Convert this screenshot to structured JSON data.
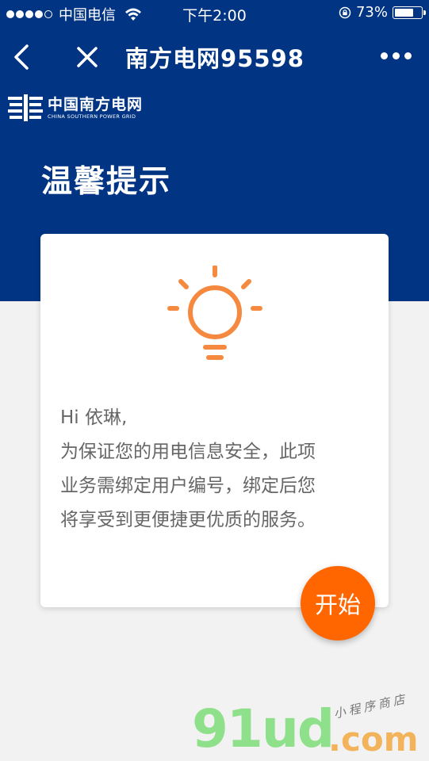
{
  "status_bar": {
    "carrier": "中国电信",
    "time": "下午2:00",
    "battery_percent": "73%",
    "battery_level": 0.73
  },
  "nav": {
    "title": "南方电网95598"
  },
  "logo": {
    "cn": "中国南方电网",
    "en": "CHINA SOUTHERN POWER GRID"
  },
  "header": {
    "headline": "温馨提示"
  },
  "card": {
    "greeting": "Hi 依琳,",
    "lines": [
      "为保证您的用电信息安全，此项",
      "业务需绑定用户编号，绑定后您",
      "将享受到更便捷更优质的服务。"
    ]
  },
  "start_button": {
    "label": "开始"
  },
  "watermark": {
    "main": "91ud",
    "domain": ".com",
    "tagline": "小程序商店"
  },
  "colors": {
    "brand_blue": "#013584",
    "accent_orange": "#ff6600",
    "bulb_orange": "#f5893f"
  }
}
